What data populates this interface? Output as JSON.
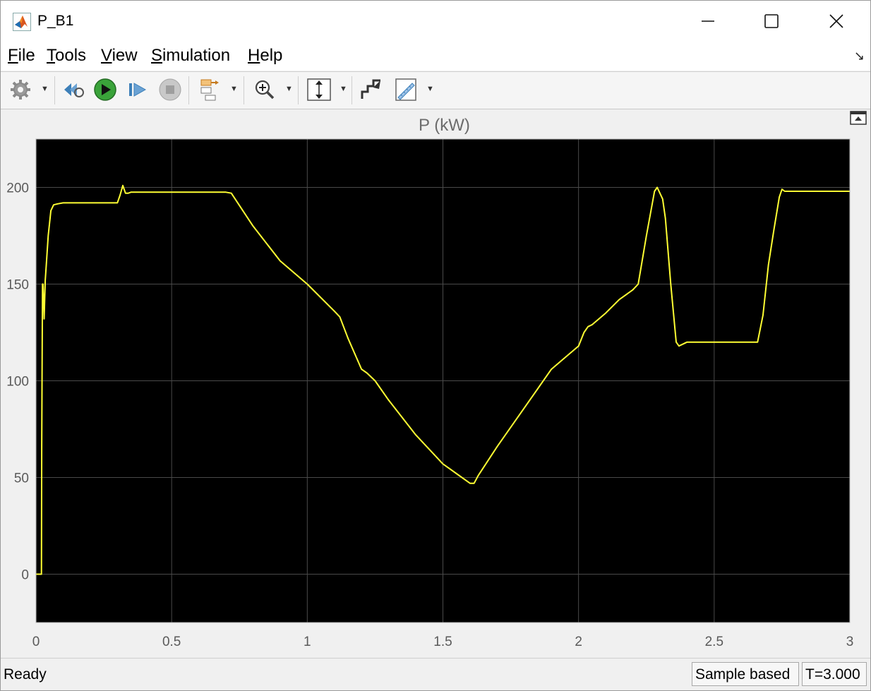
{
  "window": {
    "title": "P_B1"
  },
  "menu": {
    "items": [
      {
        "key": "F",
        "rest": "ile"
      },
      {
        "key": "T",
        "rest": "ools"
      },
      {
        "key": "V",
        "rest": "iew"
      },
      {
        "key": "S",
        "rest": "imulation"
      },
      {
        "key": "H",
        "rest": "elp"
      }
    ]
  },
  "toolbar": {
    "icons": [
      "settings-gear-icon",
      "step-back-icon",
      "run-icon",
      "step-forward-icon",
      "stop-icon",
      "signal-hierarchy-icon",
      "zoom-in-icon",
      "scale-axes-icon",
      "highlight-block-icon",
      "measurements-icon"
    ]
  },
  "chart_data": {
    "type": "line",
    "title": "P (kW)",
    "xlabel": "",
    "ylabel": "",
    "xlim": [
      0,
      3
    ],
    "ylim": [
      -25,
      225
    ],
    "xticks": [
      "0",
      "0.5",
      "1",
      "1.5",
      "2",
      "2.5",
      "3"
    ],
    "yticks": [
      "0",
      "50",
      "100",
      "150",
      "200"
    ],
    "grid": true,
    "colors": {
      "background": "#000000",
      "line": "#ffff33",
      "grid": "#4a4a4a"
    },
    "series": [
      {
        "x": [
          0,
          0.02,
          0.021,
          0.024,
          0.026,
          0.03,
          0.034,
          0.038,
          0.045,
          0.055,
          0.065,
          0.08,
          0.1,
          0.2,
          0.3,
          0.31,
          0.32,
          0.33,
          0.34,
          0.35,
          0.5,
          0.7,
          0.72,
          0.8,
          0.9,
          1.0,
          1.1,
          1.12,
          1.15,
          1.2,
          1.22,
          1.25,
          1.3,
          1.4,
          1.5,
          1.55,
          1.6,
          1.615,
          1.63,
          1.7,
          1.8,
          1.9,
          2.0,
          2.02,
          2.035,
          2.05,
          2.1,
          2.15,
          2.2,
          2.22,
          2.25,
          2.28,
          2.29,
          2.31,
          2.32,
          2.34,
          2.36,
          2.37,
          2.4,
          2.5,
          2.6,
          2.66,
          2.68,
          2.7,
          2.72,
          2.74,
          2.75,
          2.76,
          2.8,
          3.0
        ],
        "y": [
          0,
          0,
          65,
          150,
          150,
          132,
          152,
          160,
          175,
          188,
          191,
          191.5,
          192,
          192,
          192,
          196,
          201,
          197,
          197,
          197.5,
          197.5,
          197.5,
          197,
          180,
          162,
          150,
          136,
          133,
          122,
          106,
          104,
          100,
          90,
          72,
          57,
          52,
          47,
          47,
          51,
          66,
          86,
          106,
          118,
          125,
          128,
          129,
          135,
          142,
          147,
          150,
          175,
          198,
          200,
          194,
          184,
          150,
          120,
          118,
          120,
          120,
          120,
          120,
          134,
          160,
          178,
          195,
          199,
          198,
          198,
          198
        ]
      }
    ]
  },
  "status": {
    "text": "Ready",
    "mode": "Sample based",
    "time": "T=3.000"
  }
}
